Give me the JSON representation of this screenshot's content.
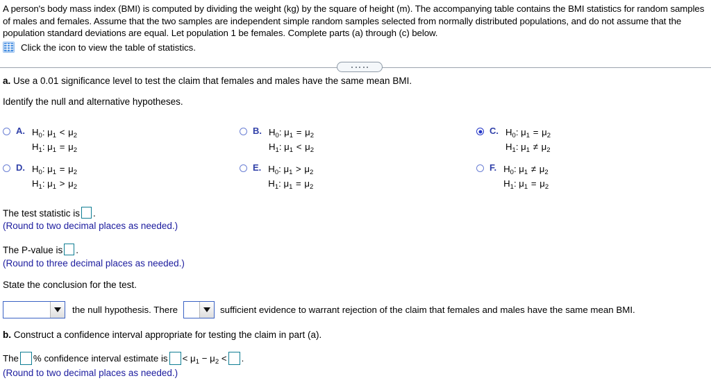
{
  "problem": {
    "intro": "A person's body mass index (BMI) is computed by dividing the weight (kg) by the square of height (m). The accompanying table contains the BMI statistics for random samples of males and females. Assume that the two samples are independent simple random samples selected from normally distributed populations, and do not assume that the population standard deviations are equal. Let population 1 be females. Complete parts (a) through (c) below.",
    "icon_name": "table-statistics-icon",
    "icon_link_text": "Click the icon to view the table of statistics.",
    "icon_color": "#3f8ae0"
  },
  "divider": {
    "dot_count": 5,
    "name": "section-expander-pill"
  },
  "part_a": {
    "prompt_label": "a.",
    "prompt_text": "Use a 0.01 significance level to test the claim that females and males have the same mean BMI.",
    "instruction": "Identify the null and alternative hypotheses.",
    "options": [
      {
        "letter": "A.",
        "null_rel": "<",
        "alt_rel": "=",
        "selected": false
      },
      {
        "letter": "B.",
        "null_rel": "=",
        "alt_rel": "<",
        "selected": false
      },
      {
        "letter": "C.",
        "null_rel": "=",
        "alt_rel": "≠",
        "selected": true
      },
      {
        "letter": "D.",
        "null_rel": "=",
        "alt_rel": ">",
        "selected": false
      },
      {
        "letter": "E.",
        "null_rel": ">",
        "alt_rel": "=",
        "selected": false
      },
      {
        "letter": "F.",
        "null_rel": "≠",
        "alt_rel": "=",
        "selected": false
      }
    ],
    "test_statistic": {
      "label_before": "The test statistic is",
      "label_after": ".",
      "value": "",
      "rounding_note": "(Round to two decimal places as needed.)"
    },
    "p_value": {
      "label_before": "The P-value is",
      "label_after": ".",
      "value": "",
      "rounding_note": "(Round to three decimal places as needed.)"
    },
    "conclusion": {
      "instruction": "State the conclusion for the test.",
      "dropdown1_value": "",
      "text_mid": "the null hypothesis. There",
      "dropdown2_value": "",
      "text_end": "sufficient evidence to warrant rejection of the claim that females and males have the same mean BMI."
    }
  },
  "part_b": {
    "prompt_label": "b.",
    "prompt_text": "Construct a confidence interval appropriate for testing the claim in part (a).",
    "line_start": "The",
    "percent_value": "",
    "line_mid": "% confidence interval estimate is",
    "lower_value": "",
    "upper_value": "",
    "line_end": ".",
    "rounding_note": "(Round to two decimal places as needed.)"
  },
  "colors": {
    "note_blue": "#1b1b9e",
    "option_letter_blue": "#2f3fa8",
    "input_border_teal": "#0e7d93",
    "dropdown_border_blue": "#3a62c4",
    "radio_selected": "#2437c8"
  }
}
